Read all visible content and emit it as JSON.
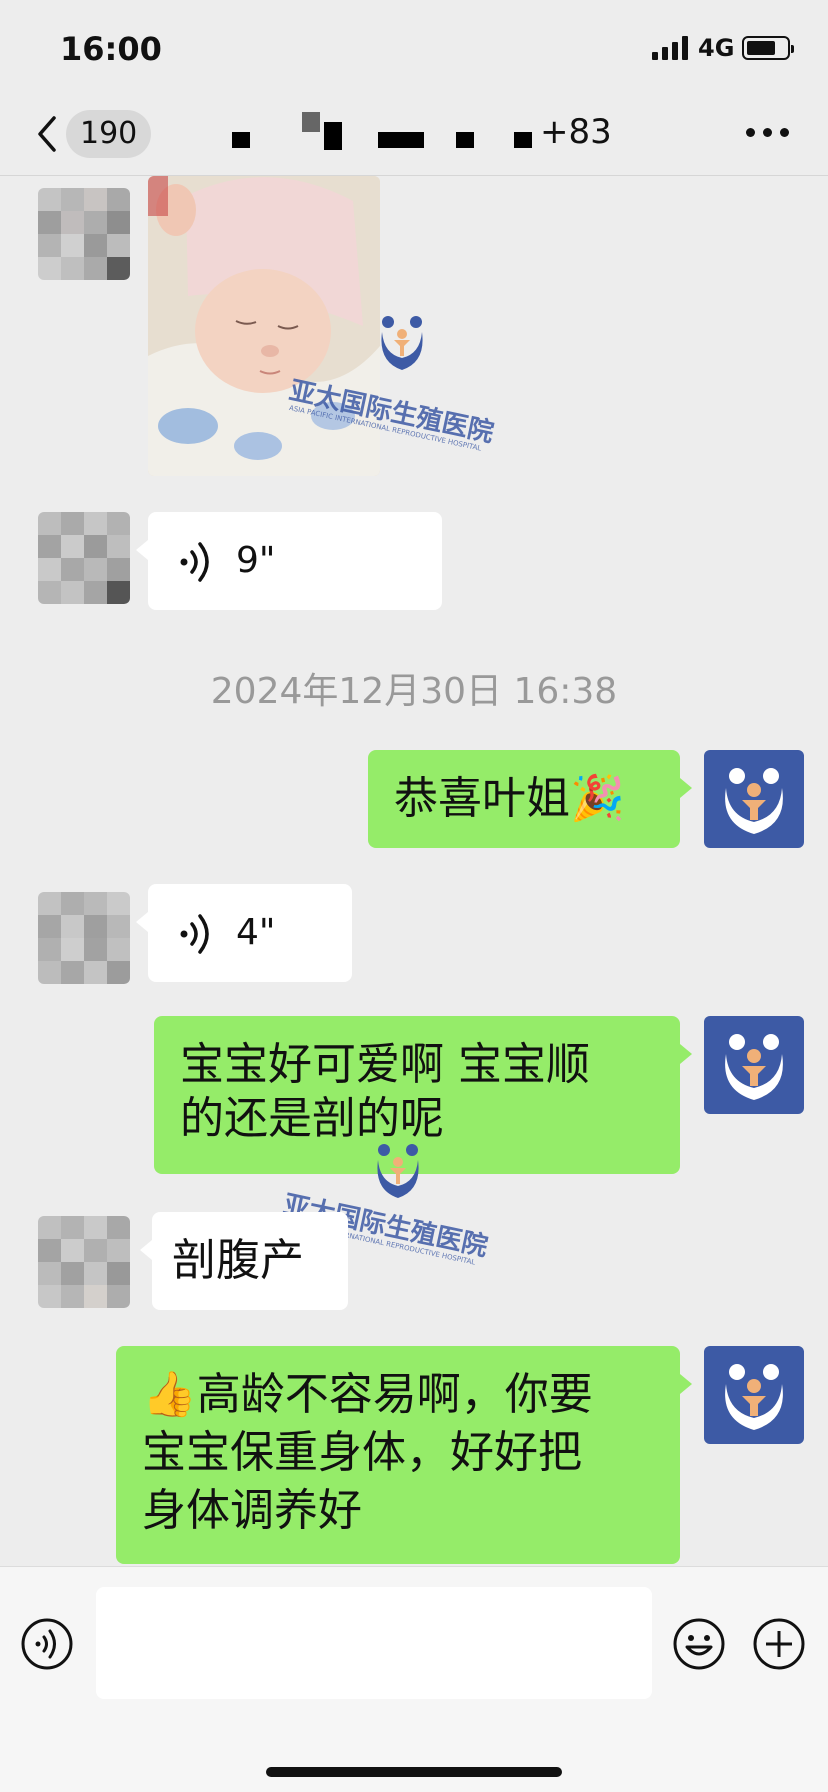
{
  "status_bar": {
    "time": "16:00",
    "network": "4G"
  },
  "nav": {
    "unread_badge": "190",
    "title_suffix": "+83",
    "icons": {
      "back": "chevron-left-icon",
      "more": "more-dots-icon"
    }
  },
  "watermark": {
    "name": "亚太国际生殖医院",
    "subtitle": "ASIA PACIFIC INTERNATIONAL REPRODUCTIVE HOSPITAL"
  },
  "messages": [
    {
      "side": "left",
      "type": "image",
      "content": "newborn-baby-photo"
    },
    {
      "side": "left",
      "type": "voice",
      "duration": "9\""
    },
    {
      "side": "right",
      "type": "text",
      "text": "恭喜叶姐🎉"
    },
    {
      "side": "left",
      "type": "voice",
      "duration": "4\""
    },
    {
      "side": "right",
      "type": "text",
      "line1": "宝宝好可爱啊 宝宝顺",
      "line2": "的还是剖的呢"
    },
    {
      "side": "left",
      "type": "text",
      "text": "剖腹产"
    },
    {
      "side": "right",
      "type": "text",
      "line1": "👍高龄不容易啊，你要",
      "line2": "宝宝保重身体，好好把",
      "line3": "身体调养好"
    }
  ],
  "timestamp": "2024年12月30日 16:38",
  "input_bar": {
    "icons": {
      "voice": "voice-mode-icon",
      "emoji": "emoji-icon",
      "plus": "plus-icon"
    }
  },
  "colors": {
    "self_bubble": "#95ec69",
    "other_bubble": "#ffffff",
    "background": "#ededed",
    "hospital_blue": "#3d5aa5"
  }
}
